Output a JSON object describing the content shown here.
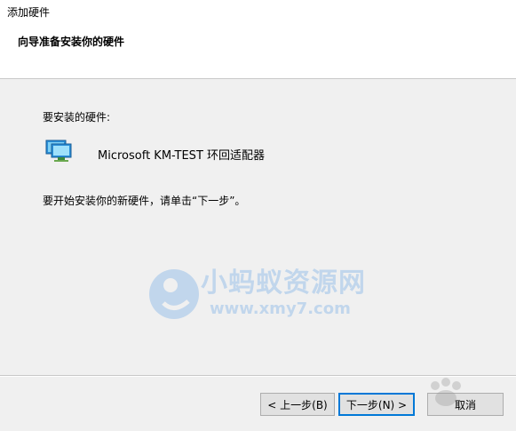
{
  "window": {
    "title": "添加硬件"
  },
  "header": {
    "title": "向导准备安装你的硬件"
  },
  "main": {
    "section_label": "要安装的硬件:",
    "device": {
      "name": "Microsoft KM-TEST 环回适配器",
      "icon": "network-adapter-icon"
    },
    "instruction": "要开始安装你的新硬件，请单击“下一步”。"
  },
  "buttons": {
    "back": "< 上一步(B)",
    "next": "下一步(N) >",
    "cancel": "取消"
  },
  "watermark": {
    "line1": "小蚂蚁资源网",
    "line2": "www.xmy7.com"
  },
  "colors": {
    "accent": "#0078d7",
    "watermark": "#8ab8e8"
  }
}
